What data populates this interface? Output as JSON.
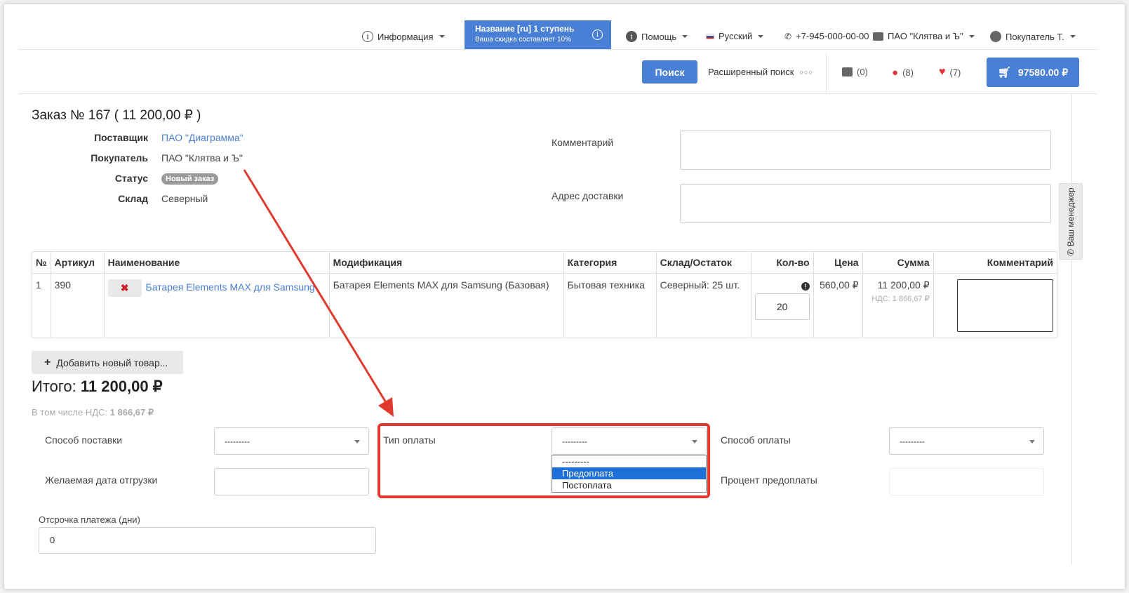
{
  "header": {
    "info_label": "Информация",
    "promo_title": "Название [ru] 1 ступень",
    "promo_sub": "Ваша скидка составляет 10%",
    "help_label": "Помощь",
    "lang_label": "Русский",
    "phone": "+7-945-000-00-00",
    "company": "ПАО \"Клятва и Ъ\"",
    "user": "Покупатель Т."
  },
  "toolbar": {
    "search_button": "Поиск",
    "advanced_search": "Расширенный поиск",
    "compare_count": "(0)",
    "notify_count": "(8)",
    "fav_count": "(7)",
    "cart_total": "97580.00 ₽"
  },
  "order": {
    "title": "Заказ № 167 ( 11 200,00 ₽ )",
    "supplier_label": "Поставщик",
    "supplier_value": "ПАО \"Диаграмма\"",
    "buyer_label": "Покупатель",
    "buyer_value": "ПАО \"Клятва и Ъ\"",
    "status_label": "Статус",
    "status_value": "Новый заказ",
    "warehouse_label": "Склад",
    "warehouse_value": "Северный",
    "comment_label": "Комментарий",
    "address_label": "Адрес доставки",
    "manager_tab": "Ваш менеджер"
  },
  "table": {
    "headers": [
      "№",
      "Артикул",
      "Наименование",
      "Модификация",
      "Категория",
      "Склад/Остаток",
      "Кол-во",
      "Цена",
      "Сумма",
      "Комментарий"
    ],
    "rows": [
      {
        "num": "1",
        "article": "390",
        "name": "Батарея Elements MAX для Samsung",
        "modification": "Батарея Elements MAX для Samsung (Базовая)",
        "category": "Бытовая техника",
        "stock": "Северный: 25 шт.",
        "qty": "20",
        "price": "560,00 ₽",
        "sum": "11 200,00 ₽",
        "vat": "НДС: 1 866,67 ₽"
      }
    ]
  },
  "totals": {
    "add_button": "Добавить новый товар...",
    "total_label": "Итого:",
    "total_value": "11 200,00 ₽",
    "vat_label": "В том числе НДС:",
    "vat_value": "1 866,67 ₽"
  },
  "form": {
    "delivery_method_label": "Способ поставки",
    "delivery_method_value": "---------",
    "ship_date_label": "Желаемая дата отгрузки",
    "payment_type_label": "Тип оплаты",
    "payment_type_value": "---------",
    "payment_type_options": [
      "---------",
      "Предоплата",
      "Постоплата"
    ],
    "payment_method_label": "Способ оплаты",
    "payment_method_value": "---------",
    "prepay_percent_label": "Процент предоплаты",
    "deferral_label": "Отсрочка платежа (дни)",
    "deferral_value": "0"
  },
  "colors": {
    "accent": "#4a7fd6",
    "highlight": "#e03a2f",
    "selected_option": "#1e70d8"
  }
}
